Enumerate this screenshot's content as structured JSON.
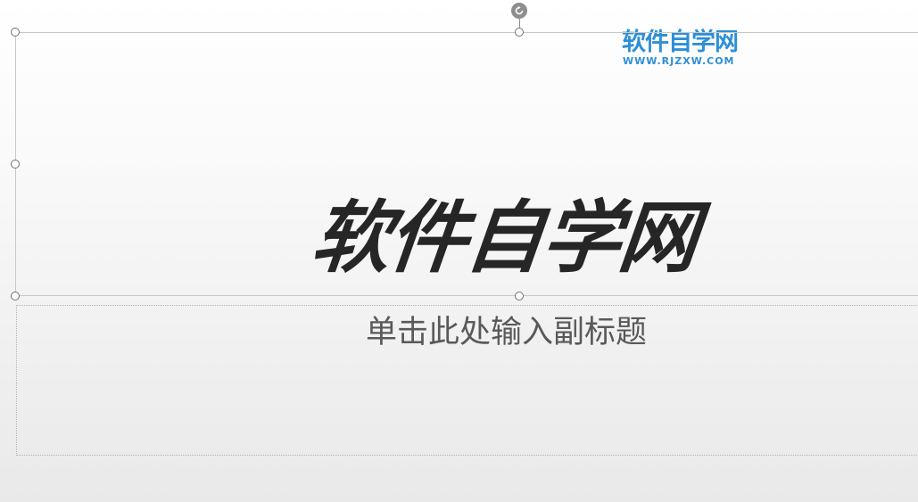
{
  "slide": {
    "title": "软件自学网",
    "subtitle_placeholder": "单击此处输入副标题"
  },
  "logo": {
    "name": "软件自学网",
    "url": "WWW.RJZXW.COM"
  },
  "colors": {
    "title": "#262626",
    "subtitle": "#595959",
    "logo": "#2d8fd6",
    "selection_border": "#c8c8c8",
    "handle_border": "#707070"
  },
  "icons": {
    "rotate": "rotate-handle-icon"
  }
}
